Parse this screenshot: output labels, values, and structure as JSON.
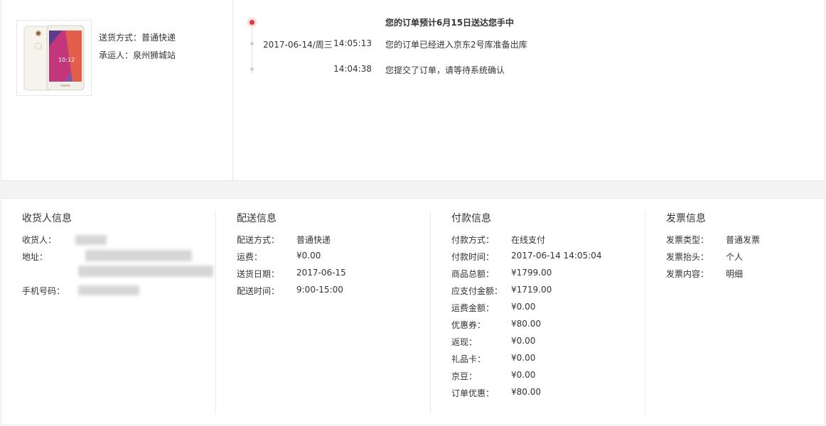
{
  "shipment": {
    "method_label": "送货方式：",
    "method_value": "普通快递",
    "carrier_label": "承运人：",
    "carrier_value": "泉州狮城站",
    "product_image_icon": "phone-product-icon"
  },
  "timeline": {
    "headline": "您的订单预计6月15日送达您手中",
    "events": [
      {
        "date": "2017-06-14/周三",
        "time": "14:05:13",
        "text": "您的订单已经进入京东2号库准备出库"
      },
      {
        "date": "",
        "time": "14:04:38",
        "text": "您提交了订单，请等待系统确认"
      }
    ],
    "current_color": "#e4393c"
  },
  "consignee": {
    "title": "收货人信息",
    "name_label": "收货人：",
    "address_label": "地址：",
    "phone_label": "手机号码："
  },
  "delivery": {
    "title": "配送信息",
    "rows": [
      {
        "label": "配送方式：",
        "value": "普通快递"
      },
      {
        "label": "运费：",
        "value": "¥0.00"
      },
      {
        "label": "送货日期：",
        "value": "2017-06-15"
      },
      {
        "label": "配送时间：",
        "value": "9:00-15:00"
      }
    ]
  },
  "payment": {
    "title": "付款信息",
    "rows": [
      {
        "label": "付款方式：",
        "value": "在线支付"
      },
      {
        "label": "付款时间：",
        "value": "2017-06-14 14:05:04"
      },
      {
        "label": "商品总额：",
        "value": "¥1799.00"
      },
      {
        "label": "应支付金额：",
        "value": "¥1719.00"
      },
      {
        "label": "运费金额：",
        "value": "¥0.00"
      },
      {
        "label": "优惠券：",
        "value": "¥80.00"
      },
      {
        "label": "返现：",
        "value": "¥0.00"
      },
      {
        "label": "礼品卡：",
        "value": "¥0.00"
      },
      {
        "label": "京豆：",
        "value": "¥0.00"
      },
      {
        "label": "订单优惠：",
        "value": "¥80.00"
      }
    ]
  },
  "invoice": {
    "title": "发票信息",
    "rows": [
      {
        "label": "发票类型：",
        "value": "普通发票"
      },
      {
        "label": "发票抬头：",
        "value": "个人"
      },
      {
        "label": "发票内容：",
        "value": "明细"
      }
    ]
  }
}
